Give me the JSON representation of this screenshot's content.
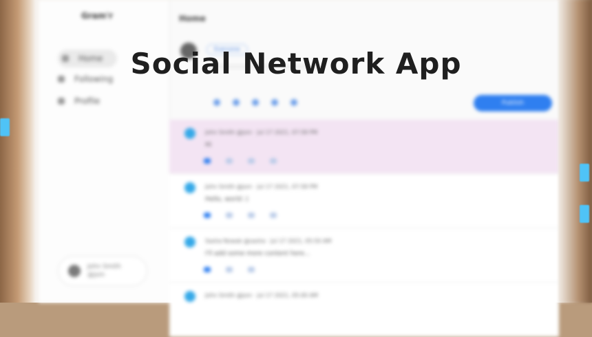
{
  "headline": "Social Network App",
  "app": {
    "brand": "Gram'r",
    "page_title": "Home",
    "sidebar": {
      "items": [
        {
          "label": "Home",
          "icon": "home-icon"
        },
        {
          "label": "Following",
          "icon": "people-icon"
        },
        {
          "label": "Profile",
          "icon": "user-icon"
        }
      ]
    },
    "user_chip": {
      "name": "John Smith",
      "handle": "@jsm"
    },
    "composer": {
      "audience": "Everyone",
      "post_label": "Publish"
    },
    "posts": [
      {
        "meta": "John Smith @jsm · Jul 17 2021, 07:58 PM",
        "body": "Hi",
        "highlight": true
      },
      {
        "meta": "John Smith @jsm · Jul 17 2021, 07:58 PM",
        "body": "Hello, world :)",
        "highlight": false
      },
      {
        "meta": "Sasha Nowak @sasha · Jul 17 2021, 05:50 AM",
        "body": "I'll add some more content here...",
        "highlight": false
      },
      {
        "meta": "John Smith @jsm · Jul 17 2021, 05:00 AM",
        "body": "",
        "highlight": false
      }
    ]
  },
  "colors": {
    "accent": "#2f7ff0",
    "highlight": "#f3e4f3",
    "avatar": "#35a9e8"
  }
}
